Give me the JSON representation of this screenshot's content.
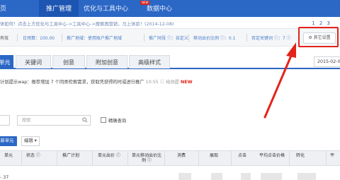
{
  "nav": {
    "home": "页",
    "promotion": "推广管理",
    "tools": "优化与工具中心",
    "data": "数据中心",
    "new_badge": "NEW"
  },
  "notice": {
    "text": "体如何！点击上方优化与工具中心->工具中心->搜索再营销，马上体验！(2014-12-08)",
    "pager": "1 2 3"
  },
  "settings": {
    "status": "有效",
    "daily_budget": "日预算：100.00",
    "region": "推广地域：使用账户推广地域",
    "time": "推广时段 ⓘ：自定义",
    "mobile_bid": "移动出价比例 ⓘ：0.1",
    "negative": "否定关键词 ⓘ：7 ⓘ",
    "other_settings": "其它设置"
  },
  "tabs": [
    {
      "label": "单元"
    },
    {
      "label": "关键词"
    },
    {
      "label": "创意"
    },
    {
      "label": "附加创意"
    },
    {
      "label": "高级样式"
    }
  ],
  "date": {
    "value": "2015-02-0"
  },
  "tip": {
    "text": "计划提示wap：推荐增加 7 个同类检索需求，获取凭获得的时或进行推广",
    "time": "10:55 ⓘ 给你提"
  },
  "search": {
    "placeholder": "搜索",
    "exact_label": "精确查询"
  },
  "actions": {
    "new_unit": "新单元",
    "edit": "编辑 ▾"
  },
  "table": {
    "headers": [
      "单元",
      "状态 ⓘ",
      "推广计划",
      "单元出价 ⓘ",
      "单元移动出价比例 ⓘ",
      "消费",
      "展现",
      "点击",
      "平均点击价格",
      "转化",
      "平"
    ],
    "row": {
      "count": "- 37"
    }
  },
  "colors": {
    "nav_blue": "#2b67c5",
    "highlight_red": "#e4231a",
    "link_blue": "#4a7fc9"
  }
}
